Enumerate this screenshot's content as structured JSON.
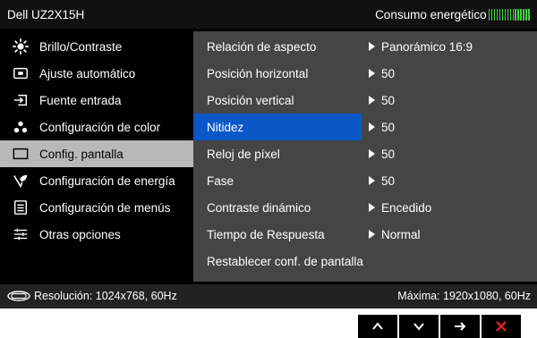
{
  "header": {
    "model": "Dell UZ2X15H",
    "energy_label": "Consumo energético",
    "energy_color": "#3fd13f"
  },
  "menu": {
    "items": [
      {
        "label": "Brillo/Contraste",
        "icon": "sun-icon",
        "selected": false
      },
      {
        "label": "Ajuste  automático",
        "icon": "auto-adjust-icon",
        "selected": false
      },
      {
        "label": "Fuente entrada",
        "icon": "input-source-icon",
        "selected": false
      },
      {
        "label": "Configuración de color",
        "icon": "color-dots-icon",
        "selected": false
      },
      {
        "label": "Config. pantalla",
        "icon": "display-rect-icon",
        "selected": true
      },
      {
        "label": "Configuración de energía",
        "icon": "energy-icon",
        "selected": false
      },
      {
        "label": "Configuración de menús",
        "icon": "menu-list-icon",
        "selected": false
      },
      {
        "label": "Otras opciones",
        "icon": "sliders-icon",
        "selected": false
      }
    ]
  },
  "settings": {
    "rows": [
      {
        "label": "Relación de aspecto",
        "value": "Panorámico 16:9",
        "selected": false
      },
      {
        "label": "Posición horizontal",
        "value": "50",
        "selected": false
      },
      {
        "label": "Posición vertical",
        "value": "50",
        "selected": false
      },
      {
        "label": "Nitidez",
        "value": "50",
        "selected": true
      },
      {
        "label": "Reloj de píxel",
        "value": "50",
        "selected": false
      },
      {
        "label": "Fase",
        "value": "50",
        "selected": false
      },
      {
        "label": "Contraste dinámico",
        "value": "Encedido",
        "selected": false
      },
      {
        "label": "Tiempo de Respuesta",
        "value": "Normal",
        "selected": false
      },
      {
        "label": "Restablecer conf. de pantalla",
        "value": "",
        "selected": false
      }
    ]
  },
  "status": {
    "resolution": "Resolución: 1024x768, 60Hz",
    "maximum": "Máxima: 1920x1080, 60Hz"
  },
  "nav_buttons": [
    {
      "icon": "up-arrow-icon",
      "color": "#ffffff"
    },
    {
      "icon": "down-arrow-icon",
      "color": "#ffffff"
    },
    {
      "icon": "right-arrow-icon",
      "color": "#ffffff"
    },
    {
      "icon": "close-icon",
      "color": "#e02020"
    }
  ]
}
